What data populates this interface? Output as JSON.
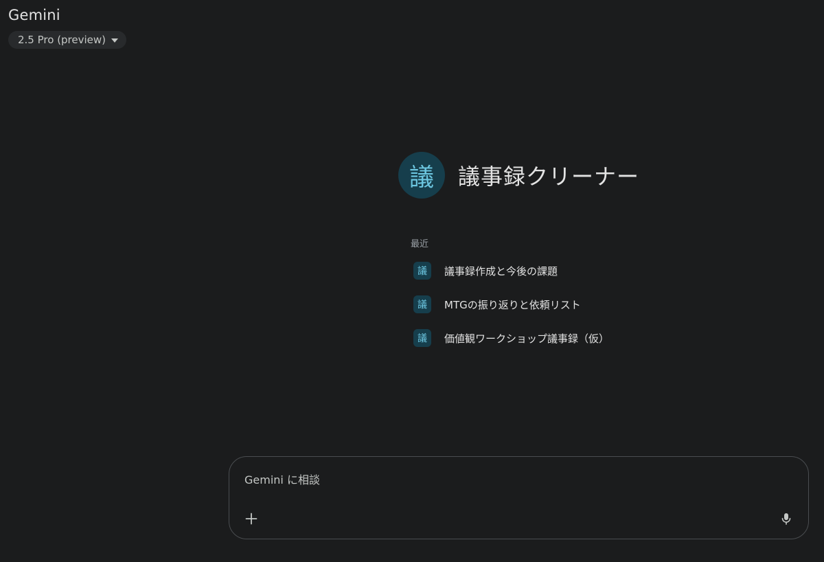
{
  "header": {
    "app_title": "Gemini",
    "model_label": "2.5 Pro (preview)"
  },
  "gem": {
    "avatar_char": "議",
    "title": "議事録クリーナー"
  },
  "recent": {
    "heading": "最近",
    "items": [
      {
        "icon_char": "議",
        "label": "議事録作成と今後の課題"
      },
      {
        "icon_char": "議",
        "label": "MTGの振り返りと依頼リスト"
      },
      {
        "icon_char": "議",
        "label": "価値観ワークショップ議事録（仮）"
      }
    ]
  },
  "prompt": {
    "placeholder": "Gemini に相談",
    "value": ""
  },
  "icons": {
    "add": "plus-icon",
    "mic": "microphone-icon",
    "model_caret": "caret-down-icon"
  },
  "colors": {
    "background": "#1b1c1d",
    "accent": "#6cc6e0",
    "accent_bg": "#163e4c"
  }
}
